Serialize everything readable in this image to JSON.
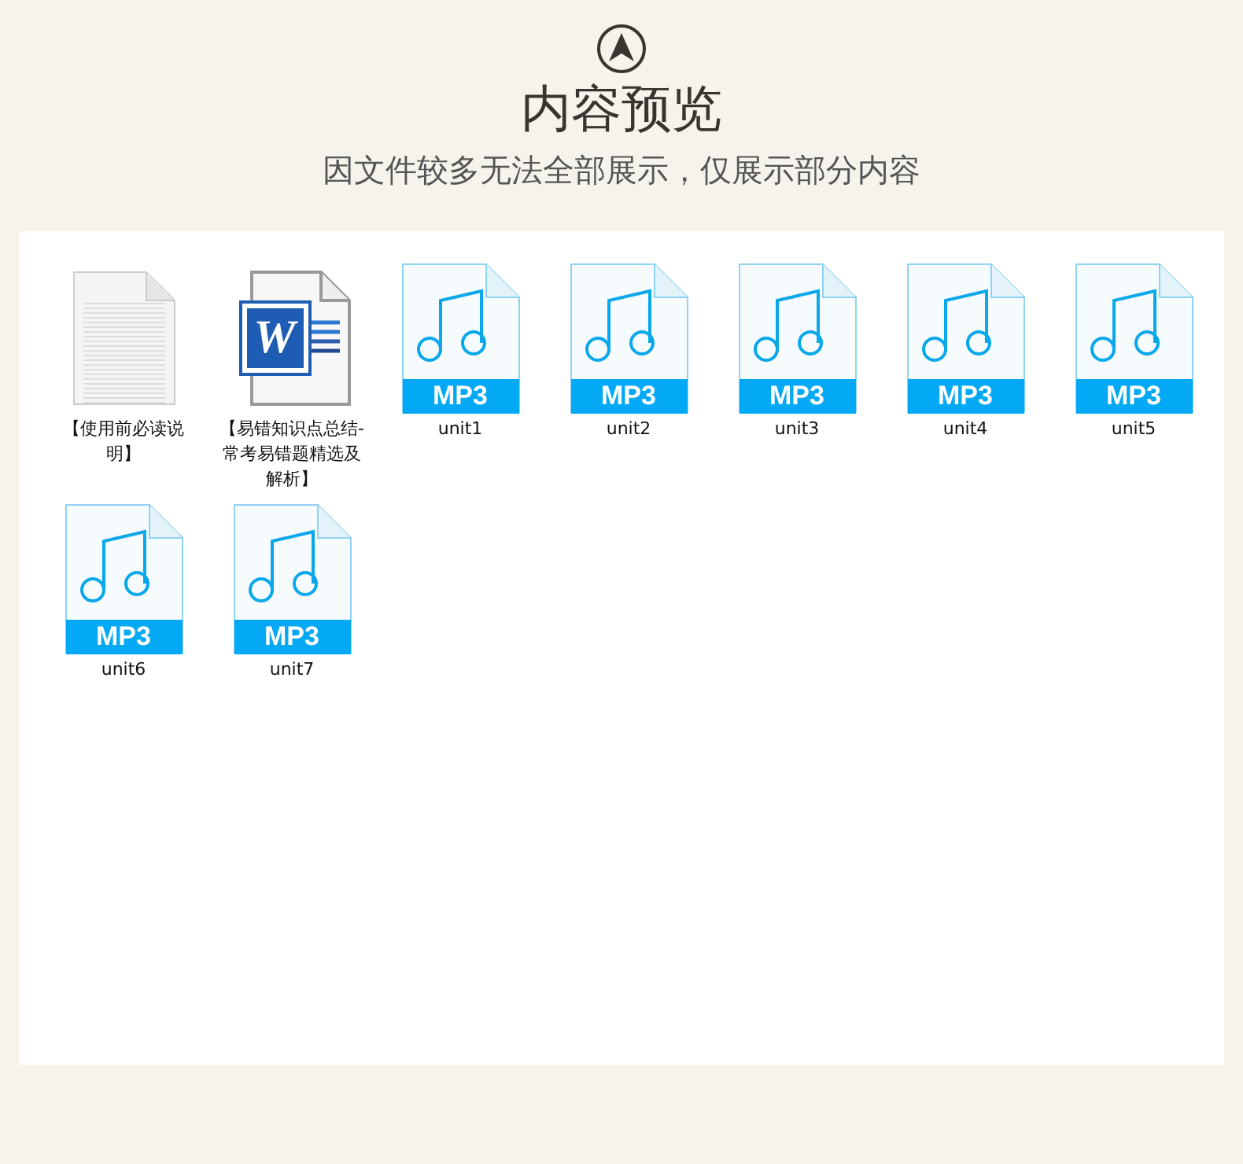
{
  "header": {
    "title": "内容预览",
    "subtitle": "因文件较多无法全部展示，仅展示部分内容"
  },
  "files": [
    {
      "kind": "text",
      "name": "【使用前必读说明】"
    },
    {
      "kind": "word",
      "badge": "W",
      "name": "【易错知识点总结-常考易错题精选及解析】"
    },
    {
      "kind": "mp3",
      "badge": "MP3",
      "name": "unit1"
    },
    {
      "kind": "mp3",
      "badge": "MP3",
      "name": "unit2"
    },
    {
      "kind": "mp3",
      "badge": "MP3",
      "name": "unit3"
    },
    {
      "kind": "mp3",
      "badge": "MP3",
      "name": "unit4"
    },
    {
      "kind": "mp3",
      "badge": "MP3",
      "name": "unit5"
    },
    {
      "kind": "mp3",
      "badge": "MP3",
      "name": "unit6"
    },
    {
      "kind": "mp3",
      "badge": "MP3",
      "name": "unit7"
    }
  ]
}
